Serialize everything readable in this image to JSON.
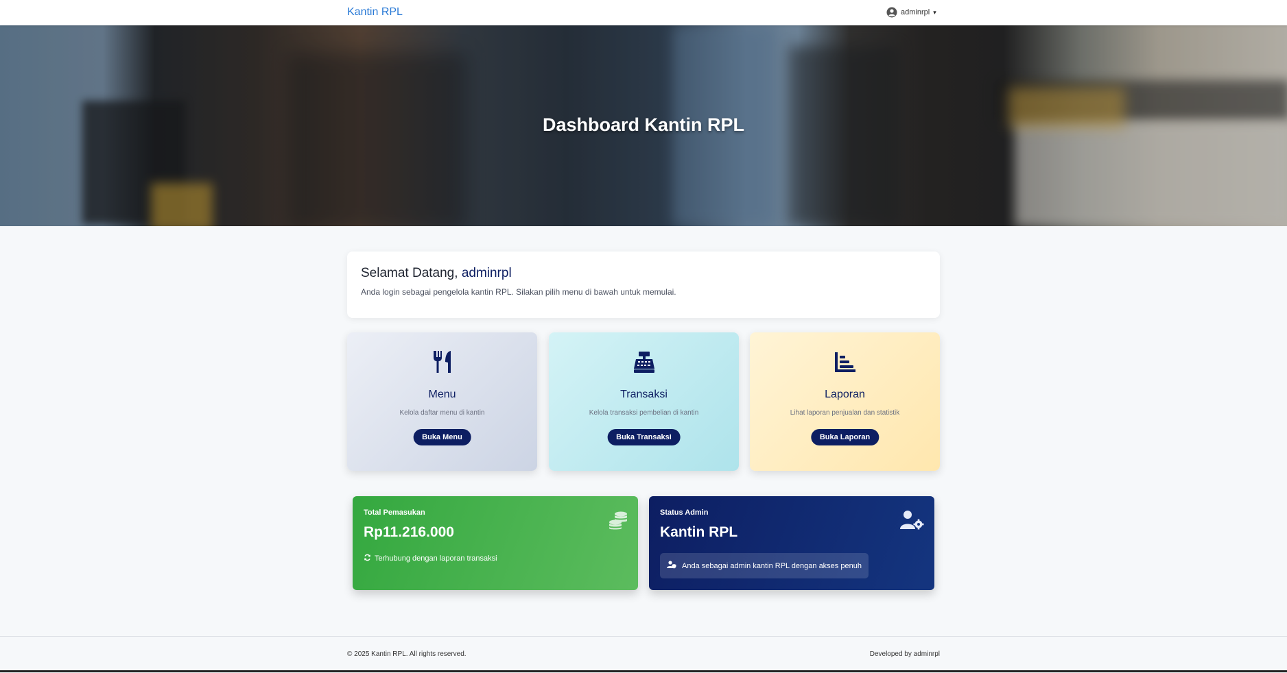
{
  "navbar": {
    "brand": "Kantin RPL",
    "user": "adminrpl",
    "user_icon": "user-circle-icon",
    "caret": "▾"
  },
  "hero": {
    "title": "Dashboard Kantin RPL"
  },
  "welcome": {
    "greeting": "Selamat Datang,",
    "username": "adminrpl",
    "subtitle": "Anda login sebagai pengelola kantin RPL. Silakan pilih menu di bawah untuk memulai."
  },
  "features": [
    {
      "icon": "utensils-icon",
      "title": "Menu",
      "description": "Kelola daftar menu di kantin",
      "button": "Buka Menu"
    },
    {
      "icon": "cash-register-icon",
      "title": "Transaksi",
      "description": "Kelola transaksi pembelian di kantin",
      "button": "Buka Transaksi"
    },
    {
      "icon": "chart-icon",
      "title": "Laporan",
      "description": "Lihat laporan penjualan dan statistik",
      "button": "Buka Laporan"
    }
  ],
  "stats": {
    "income": {
      "label": "Total Pemasukan",
      "value": "Rp11.216.000",
      "note": "Terhubung dengan laporan transaksi",
      "icon": "coins-icon",
      "note_icon": "sync-icon",
      "color": "#3fae44"
    },
    "admin": {
      "label": "Status Admin",
      "value": "Kantin RPL",
      "note": "Anda sebagai admin kantin RPL dengan akses penuh",
      "icon": "user-gear-icon",
      "note_icon": "user-shield-icon",
      "color": "#0d1e62"
    }
  },
  "footer": {
    "copyright": "© 2025 Kantin RPL. All rights reserved.",
    "developer": "Developed by adminrpl"
  },
  "colors": {
    "primary": "#0d1e62",
    "brand_link": "#2a7ad6",
    "background": "#f6f8fa"
  }
}
